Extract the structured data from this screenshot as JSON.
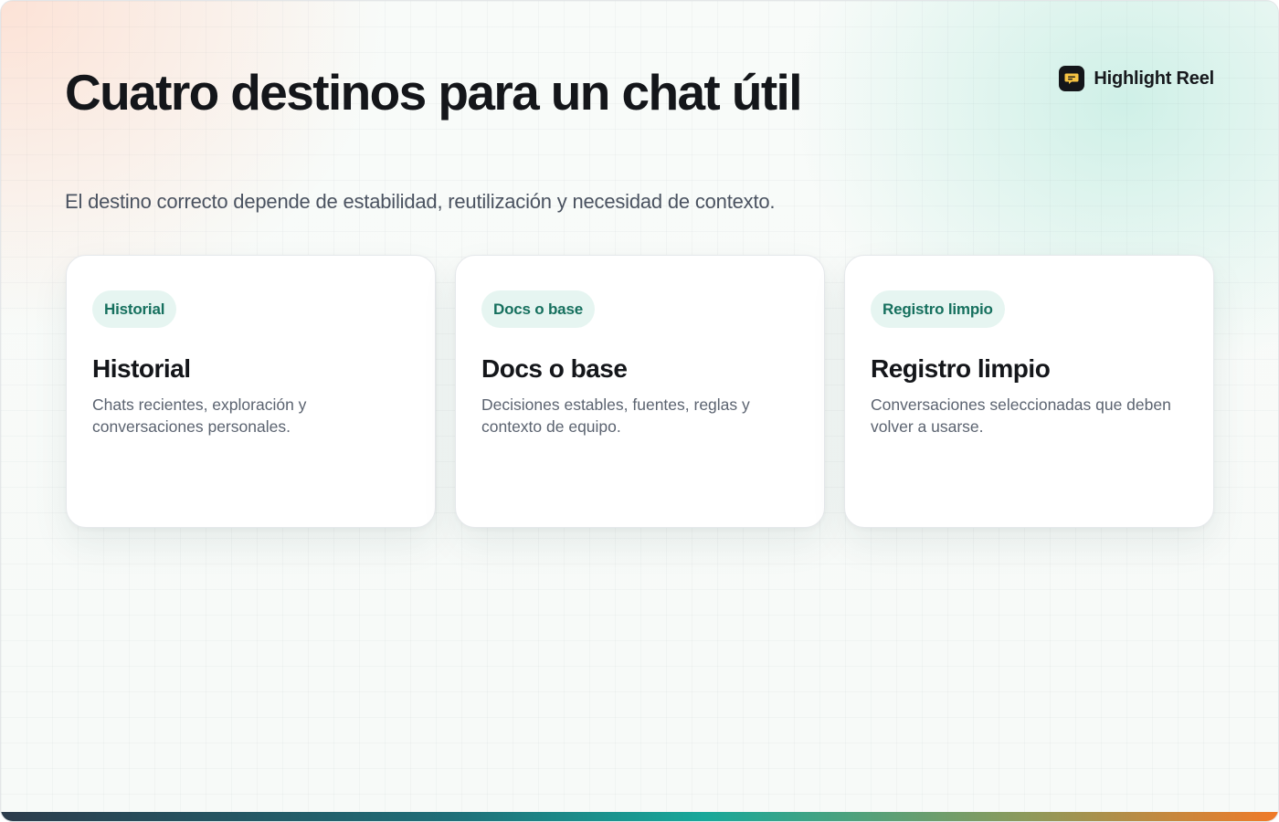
{
  "brand": {
    "name": "Highlight Reel",
    "icon": "chat-bubble-icon",
    "icon_color": "#f6c343"
  },
  "header": {
    "title": "Cuatro destinos para un chat útil",
    "subtitle": "El destino correcto depende de estabilidad, reutilización y necesidad de contexto."
  },
  "cards": [
    {
      "badge": "Historial",
      "title": "Historial",
      "description": "Chats recientes, exploración y conversaciones personales."
    },
    {
      "badge": "Docs o base",
      "title": "Docs o base",
      "description": "Decisiones estables, fuentes, reglas y contexto de equipo."
    },
    {
      "badge": "Registro limpio",
      "title": "Registro limpio",
      "description": "Conversaciones seleccionadas que deben volver a usarse."
    }
  ],
  "colors": {
    "accent": "#16705e",
    "badge_bg": "#e6f5f1",
    "text": "#14161a",
    "muted": "#5b6370"
  }
}
